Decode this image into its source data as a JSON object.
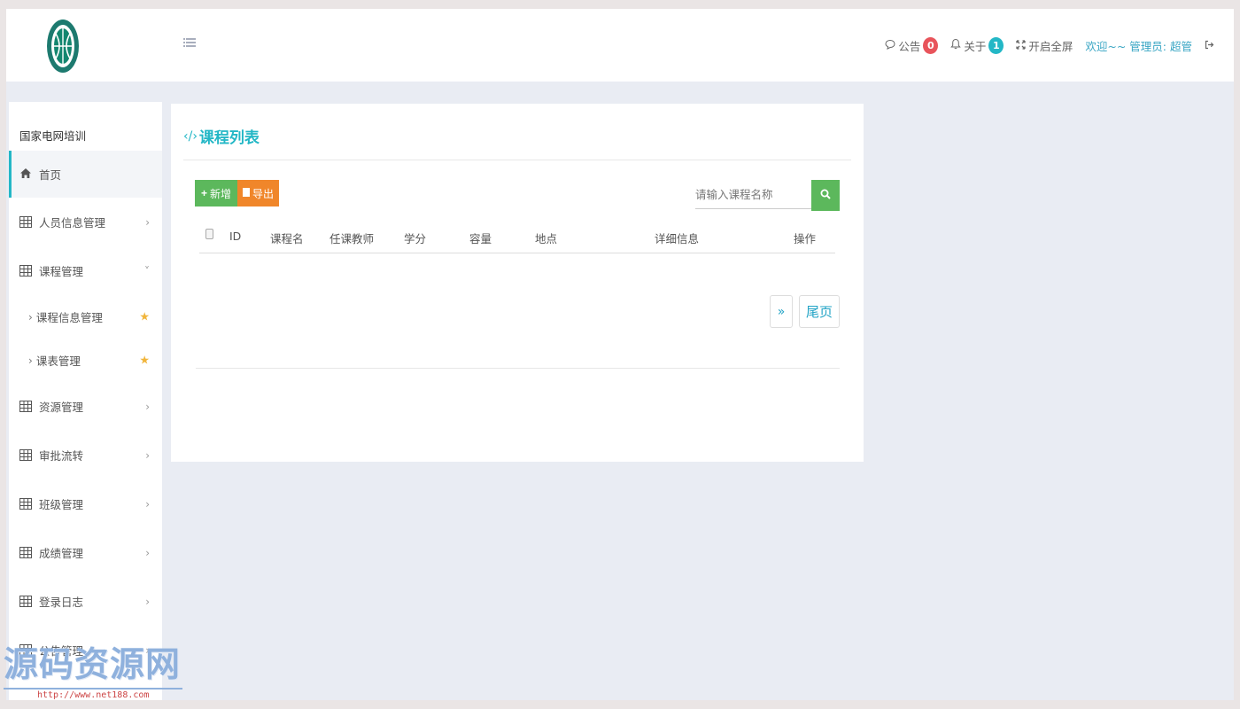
{
  "header": {
    "notice_label": "公告",
    "notice_count": "0",
    "about_label": "关于",
    "about_count": "1",
    "fullscreen_label": "开启全屏",
    "welcome_text": "欢迎~~ 管理员: 超管",
    "colors": {
      "notice_badge": "#e8545b",
      "about_badge": "#23b7c6"
    }
  },
  "sidebar": {
    "brand": "国家电网培训",
    "items": [
      {
        "label": "首页",
        "icon": "home-icon",
        "active": true
      },
      {
        "label": "人员信息管理",
        "icon": "grid-icon",
        "chevron": "›"
      },
      {
        "label": "课程管理",
        "icon": "grid-icon",
        "chevron": "˅",
        "expanded": true
      },
      {
        "label": "课程信息管理",
        "sub": true
      },
      {
        "label": "课表管理",
        "sub": true
      },
      {
        "label": "资源管理",
        "icon": "grid-icon",
        "chevron": "›"
      },
      {
        "label": "审批流转",
        "icon": "grid-icon",
        "chevron": "›"
      },
      {
        "label": "班级管理",
        "icon": "grid-icon",
        "chevron": "›"
      },
      {
        "label": "成绩管理",
        "icon": "grid-icon",
        "chevron": "›"
      },
      {
        "label": "登录日志",
        "icon": "grid-icon",
        "chevron": "›"
      },
      {
        "label": "公告管理",
        "icon": "grid-icon",
        "chevron": "›"
      }
    ]
  },
  "main": {
    "title": "课程列表",
    "add_label": "新增",
    "export_label": "导出",
    "search_placeholder": "请输入课程名称",
    "columns": [
      "ID",
      "课程名",
      "任课教师",
      "学分",
      "容量",
      "地点",
      "详细信息",
      "操作"
    ],
    "pagination": {
      "next": "»",
      "last": "尾页"
    }
  },
  "watermark": {
    "text": "源码资源网",
    "url": "http://www.net188.com"
  },
  "theme": {
    "accent": "#23b7c6",
    "green": "#5cb85c",
    "orange": "#f0862a"
  }
}
